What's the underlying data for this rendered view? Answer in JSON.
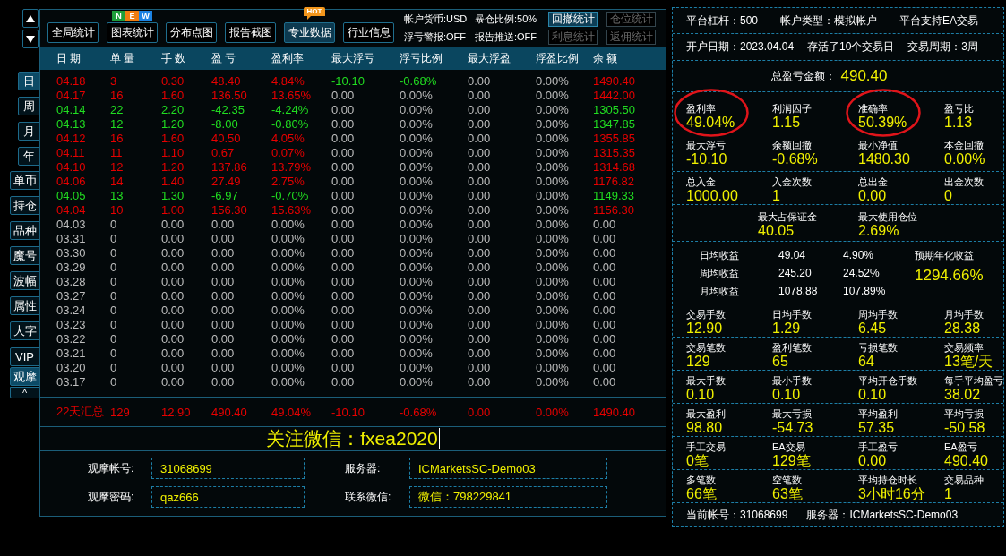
{
  "period_tabs": [
    {
      "label": "日",
      "selected": true
    },
    {
      "label": "周",
      "selected": false
    },
    {
      "label": "月",
      "selected": false
    },
    {
      "label": "年",
      "selected": false
    }
  ],
  "tool_tabs": [
    {
      "label": "单币",
      "selected": false
    },
    {
      "label": "持仓",
      "selected": false
    },
    {
      "label": "品种",
      "selected": false
    },
    {
      "label": "魔号",
      "selected": false
    },
    {
      "label": "波幅",
      "selected": false
    },
    {
      "label": "属性",
      "selected": false
    },
    {
      "label": "大字",
      "selected": false
    }
  ],
  "view_tabs": [
    {
      "label": "VIP",
      "selected": false
    },
    {
      "label": "观摩",
      "selected": true
    }
  ],
  "collapse_button": {
    "label": "^"
  },
  "toolbar": {
    "buttons": [
      {
        "label": "全局统计",
        "selected": false
      },
      {
        "label": "图表统计",
        "selected": false,
        "badge": {
          "kind": "new",
          "letters": [
            {
              "text": "N",
              "color": "#1f9e3b"
            },
            {
              "text": "E",
              "color": "#f07c10"
            },
            {
              "text": "W",
              "color": "#1b82e3"
            }
          ]
        }
      },
      {
        "label": "分布点图",
        "selected": false
      },
      {
        "label": "报告截图",
        "selected": false
      },
      {
        "label": "专业数据",
        "selected": true,
        "badge": {
          "kind": "hot",
          "text": "HOT"
        }
      },
      {
        "label": "行业信息",
        "selected": false
      }
    ],
    "account_info": [
      "帐户货币:USD",
      "暴仓比例:50%",
      "浮亏警报:OFF",
      "报告推送:OFF"
    ],
    "stat_buttons": [
      {
        "label": "回撤统计",
        "disabled": false
      },
      {
        "label": "仓位统计",
        "disabled": true
      },
      {
        "label": "利息统计",
        "disabled": true
      },
      {
        "label": "返佣统计",
        "disabled": true
      }
    ]
  },
  "table": {
    "columns": [
      "日 期",
      "单 量",
      "手 数",
      "盈 亏",
      "盈利率",
      "最大浮亏",
      "浮亏比例",
      "最大浮盈",
      "浮盈比例",
      "余 额"
    ],
    "rows": [
      {
        "cells": [
          "04.18",
          "3",
          "0.30",
          "48.40",
          "4.84%",
          "-10.10",
          "-0.68%",
          "0.00",
          "0.00%",
          "1490.40"
        ],
        "color": "#e60000",
        "float_loss": {
          "color": "#21dd21"
        }
      },
      {
        "cells": [
          "04.17",
          "16",
          "1.60",
          "136.50",
          "13.65%",
          "0.00",
          "0.00%",
          "0.00",
          "0.00%",
          "1442.00"
        ],
        "color": "#e60000",
        "float_loss": {
          "color": "#bdbdbd"
        }
      },
      {
        "cells": [
          "04.14",
          "22",
          "2.20",
          "-42.35",
          "-4.24%",
          "0.00",
          "0.00%",
          "0.00",
          "0.00%",
          "1305.50"
        ],
        "color": "#21dd21",
        "float_loss": {
          "color": "#bdbdbd"
        }
      },
      {
        "cells": [
          "04.13",
          "12",
          "1.20",
          "-8.00",
          "-0.80%",
          "0.00",
          "0.00%",
          "0.00",
          "0.00%",
          "1347.85"
        ],
        "color": "#21dd21",
        "float_loss": {
          "color": "#bdbdbd"
        }
      },
      {
        "cells": [
          "04.12",
          "16",
          "1.60",
          "40.50",
          "4.05%",
          "0.00",
          "0.00%",
          "0.00",
          "0.00%",
          "1355.85"
        ],
        "color": "#e60000",
        "float_loss": {
          "color": "#bdbdbd"
        }
      },
      {
        "cells": [
          "04.11",
          "11",
          "1.10",
          "0.67",
          "0.07%",
          "0.00",
          "0.00%",
          "0.00",
          "0.00%",
          "1315.35"
        ],
        "color": "#e60000",
        "float_loss": {
          "color": "#bdbdbd"
        }
      },
      {
        "cells": [
          "04.10",
          "12",
          "1.20",
          "137.86",
          "13.79%",
          "0.00",
          "0.00%",
          "0.00",
          "0.00%",
          "1314.68"
        ],
        "color": "#e60000",
        "float_loss": {
          "color": "#bdbdbd"
        }
      },
      {
        "cells": [
          "04.06",
          "14",
          "1.40",
          "27.49",
          "2.75%",
          "0.00",
          "0.00%",
          "0.00",
          "0.00%",
          "1176.82"
        ],
        "color": "#e60000",
        "float_loss": {
          "color": "#bdbdbd"
        }
      },
      {
        "cells": [
          "04.05",
          "13",
          "1.30",
          "-6.97",
          "-0.70%",
          "0.00",
          "0.00%",
          "0.00",
          "0.00%",
          "1149.33"
        ],
        "color": "#21dd21",
        "float_loss": {
          "color": "#bdbdbd"
        }
      },
      {
        "cells": [
          "04.04",
          "10",
          "1.00",
          "156.30",
          "15.63%",
          "0.00",
          "0.00%",
          "0.00",
          "0.00%",
          "1156.30"
        ],
        "color": "#e60000",
        "float_loss": {
          "color": "#bdbdbd"
        }
      },
      {
        "cells": [
          "04.03",
          "0",
          "0.00",
          "0.00",
          "0.00%",
          "0.00",
          "0.00%",
          "0.00",
          "0.00%",
          "0.00"
        ],
        "color": "#bdbdbd",
        "float_loss": {
          "color": "#bdbdbd"
        }
      },
      {
        "cells": [
          "03.31",
          "0",
          "0.00",
          "0.00",
          "0.00%",
          "0.00",
          "0.00%",
          "0.00",
          "0.00%",
          "0.00"
        ],
        "color": "#bdbdbd",
        "float_loss": {
          "color": "#bdbdbd"
        }
      },
      {
        "cells": [
          "03.30",
          "0",
          "0.00",
          "0.00",
          "0.00%",
          "0.00",
          "0.00%",
          "0.00",
          "0.00%",
          "0.00"
        ],
        "color": "#bdbdbd",
        "float_loss": {
          "color": "#bdbdbd"
        }
      },
      {
        "cells": [
          "03.29",
          "0",
          "0.00",
          "0.00",
          "0.00%",
          "0.00",
          "0.00%",
          "0.00",
          "0.00%",
          "0.00"
        ],
        "color": "#bdbdbd",
        "float_loss": {
          "color": "#bdbdbd"
        }
      },
      {
        "cells": [
          "03.28",
          "0",
          "0.00",
          "0.00",
          "0.00%",
          "0.00",
          "0.00%",
          "0.00",
          "0.00%",
          "0.00"
        ],
        "color": "#bdbdbd",
        "float_loss": {
          "color": "#bdbdbd"
        }
      },
      {
        "cells": [
          "03.27",
          "0",
          "0.00",
          "0.00",
          "0.00%",
          "0.00",
          "0.00%",
          "0.00",
          "0.00%",
          "0.00"
        ],
        "color": "#bdbdbd",
        "float_loss": {
          "color": "#bdbdbd"
        }
      },
      {
        "cells": [
          "03.24",
          "0",
          "0.00",
          "0.00",
          "0.00%",
          "0.00",
          "0.00%",
          "0.00",
          "0.00%",
          "0.00"
        ],
        "color": "#bdbdbd",
        "float_loss": {
          "color": "#bdbdbd"
        }
      },
      {
        "cells": [
          "03.23",
          "0",
          "0.00",
          "0.00",
          "0.00%",
          "0.00",
          "0.00%",
          "0.00",
          "0.00%",
          "0.00"
        ],
        "color": "#bdbdbd",
        "float_loss": {
          "color": "#bdbdbd"
        }
      },
      {
        "cells": [
          "03.22",
          "0",
          "0.00",
          "0.00",
          "0.00%",
          "0.00",
          "0.00%",
          "0.00",
          "0.00%",
          "0.00"
        ],
        "color": "#bdbdbd",
        "float_loss": {
          "color": "#bdbdbd"
        }
      },
      {
        "cells": [
          "03.21",
          "0",
          "0.00",
          "0.00",
          "0.00%",
          "0.00",
          "0.00%",
          "0.00",
          "0.00%",
          "0.00"
        ],
        "color": "#bdbdbd",
        "float_loss": {
          "color": "#bdbdbd"
        }
      },
      {
        "cells": [
          "03.20",
          "0",
          "0.00",
          "0.00",
          "0.00%",
          "0.00",
          "0.00%",
          "0.00",
          "0.00%",
          "0.00"
        ],
        "color": "#bdbdbd",
        "float_loss": {
          "color": "#bdbdbd"
        }
      },
      {
        "cells": [
          "03.17",
          "0",
          "0.00",
          "0.00",
          "0.00%",
          "0.00",
          "0.00%",
          "0.00",
          "0.00%",
          "0.00"
        ],
        "color": "#bdbdbd",
        "float_loss": {
          "color": "#bdbdbd"
        }
      }
    ],
    "summary": {
      "cells": [
        "22天汇总",
        "129",
        "12.90",
        "490.40",
        "49.04%",
        "-10.10",
        "-0.68%",
        "0.00",
        "0.00%",
        "1490.40"
      ],
      "color": "#e60000"
    }
  },
  "banner": {
    "text": "关注微信：fxea2020"
  },
  "watch_form": [
    {
      "label": "观摩帐号:",
      "value": "31068699"
    },
    {
      "label": "服务器:",
      "value": "ICMarketsSC-Demo03"
    },
    {
      "label": "观摩密码:",
      "value": "qaz666"
    },
    {
      "label": "联系微信:",
      "value": "微信：798229841"
    }
  ],
  "summary_panel": {
    "info_rows": [
      [
        "平台杠杆：500",
        "帐户类型：模拟帐户",
        "平台支持EA交易"
      ],
      [
        "开户日期：2023.04.04",
        "存活了10个交易日",
        "交易周期：3周"
      ]
    ],
    "total_pnl": {
      "label": "总盈亏金额：",
      "value": "490.40"
    },
    "sections": [
      {
        "kind": "quad",
        "items": [
          {
            "label": "盈利率",
            "value": "49.04%",
            "circled": true
          },
          {
            "label": "利润因子",
            "value": "1.15",
            "circled": false
          },
          {
            "label": "准确率",
            "value": "50.39%",
            "circled": true
          },
          {
            "label": "盈亏比",
            "value": "1.13",
            "circled": false
          },
          {
            "label": "最大浮亏",
            "value": "-10.10",
            "circled": false
          },
          {
            "label": "余额回撤",
            "value": "-0.68%",
            "circled": false
          },
          {
            "label": "最小净值",
            "value": "1480.30",
            "circled": false
          },
          {
            "label": "本金回撤",
            "value": "0.00%",
            "circled": false
          }
        ]
      },
      {
        "kind": "quad",
        "items": [
          {
            "label": "总入金",
            "value": "1000.00",
            "circled": false
          },
          {
            "label": "入金次数",
            "value": "1",
            "circled": false
          },
          {
            "label": "总出金",
            "value": "0.00",
            "circled": false
          },
          {
            "label": "出金次数",
            "value": "0",
            "circled": false
          }
        ]
      },
      {
        "kind": "pair",
        "items": [
          {
            "label": "最大占保证金",
            "value": "40.05",
            "circled": false
          },
          {
            "label": "最大使用仓位",
            "value": "2.69%",
            "circled": false
          }
        ]
      },
      {
        "kind": "returns",
        "rows": [
          {
            "label": "日均收益",
            "amount": "49.04",
            "percent": "4.90%"
          },
          {
            "label": "周均收益",
            "amount": "245.20",
            "percent": "24.52%"
          },
          {
            "label": "月均收益",
            "amount": "1078.88",
            "percent": "107.89%"
          }
        ],
        "annual": {
          "label": "预期年化收益",
          "value": "1294.66%"
        }
      },
      {
        "kind": "quad",
        "items": [
          {
            "label": "交易手数",
            "value": "12.90",
            "circled": false
          },
          {
            "label": "日均手数",
            "value": "1.29",
            "circled": false
          },
          {
            "label": "周均手数",
            "value": "6.45",
            "circled": false
          },
          {
            "label": "月均手数",
            "value": "28.38",
            "circled": false
          }
        ]
      },
      {
        "kind": "quad",
        "items": [
          {
            "label": "交易笔数",
            "value": "129",
            "circled": false
          },
          {
            "label": "盈利笔数",
            "value": "65",
            "circled": false
          },
          {
            "label": "亏损笔数",
            "value": "64",
            "circled": false
          },
          {
            "label": "交易频率",
            "value": "13笔/天",
            "circled": false
          }
        ]
      },
      {
        "kind": "quad",
        "items": [
          {
            "label": "最大手数",
            "value": "0.10",
            "circled": false
          },
          {
            "label": "最小手数",
            "value": "0.10",
            "circled": false
          },
          {
            "label": "平均开仓手数",
            "value": "0.10",
            "circled": false
          },
          {
            "label": "每手平均盈亏",
            "value": "38.02",
            "circled": false
          }
        ]
      },
      {
        "kind": "quad",
        "items": [
          {
            "label": "最大盈利",
            "value": "98.80",
            "circled": false
          },
          {
            "label": "最大亏损",
            "value": "-54.73",
            "circled": false
          },
          {
            "label": "平均盈利",
            "value": "57.35",
            "circled": false
          },
          {
            "label": "平均亏损",
            "value": "-50.58",
            "circled": false
          }
        ]
      },
      {
        "kind": "quad",
        "items": [
          {
            "label": "手工交易",
            "value": "0笔",
            "circled": false
          },
          {
            "label": "EA交易",
            "value": "129笔",
            "circled": false
          },
          {
            "label": "手工盈亏",
            "value": "0.00",
            "circled": false
          },
          {
            "label": "EA盈亏",
            "value": "490.40",
            "circled": false
          }
        ]
      },
      {
        "kind": "quad",
        "items": [
          {
            "label": "多笔数",
            "value": "66笔",
            "circled": false
          },
          {
            "label": "空笔数",
            "value": "63笔",
            "circled": false
          },
          {
            "label": "平均持仓时长",
            "value": "3小时16分",
            "circled": false
          },
          {
            "label": "交易品种",
            "value": "1",
            "circled": false
          }
        ]
      }
    ],
    "footer": [
      "当前帐号：31068699",
      "服务器：ICMarketsSC-Demo03"
    ]
  }
}
